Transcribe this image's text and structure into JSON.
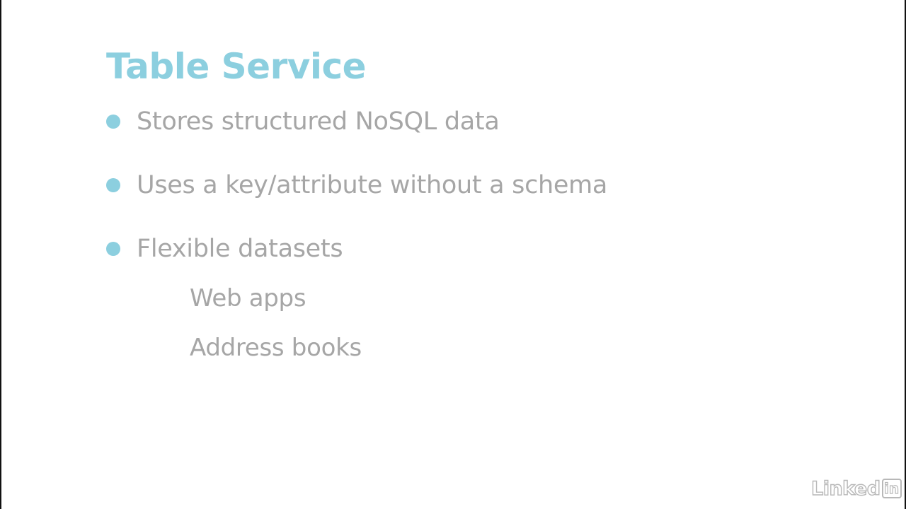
{
  "slide": {
    "title": "Table Service",
    "bullets": [
      {
        "text": "Stores structured NoSQL data"
      },
      {
        "text": "Uses a key/attribute without a schema"
      },
      {
        "text": "Flexible datasets"
      }
    ],
    "sub_items": [
      {
        "text": "Web apps"
      },
      {
        "text": "Address books"
      }
    ]
  },
  "branding": {
    "logo_word": "Linked",
    "logo_box": "in"
  },
  "colors": {
    "title": "#8ccfdf",
    "bullet_dot": "#8ccfdf",
    "text": "#a6a6a6",
    "logo": "#b8b8b8",
    "background": "#ffffff"
  }
}
